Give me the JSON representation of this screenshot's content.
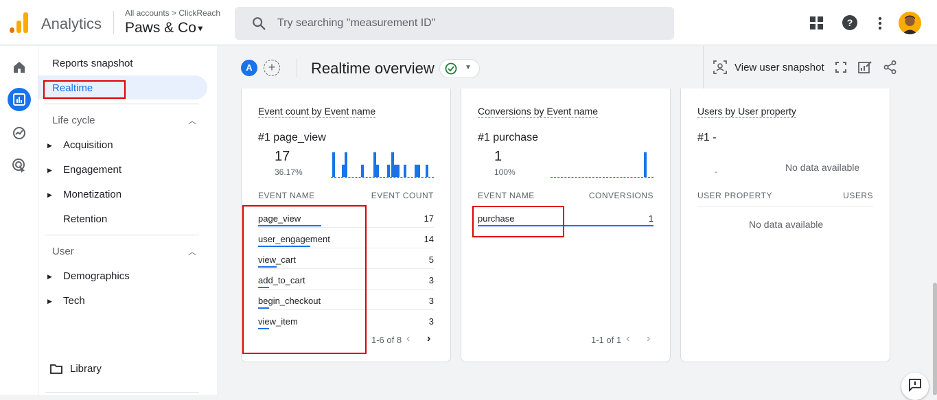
{
  "header": {
    "app_name": "Analytics",
    "breadcrumb": "All accounts > ClickReach",
    "property": "Paws & Co",
    "search_placeholder": "Try searching \"measurement ID\"",
    "icons": [
      "apps-grid-icon",
      "help-icon",
      "more-vert-icon",
      "avatar"
    ]
  },
  "rail": {
    "items": [
      "home-icon",
      "reports-icon",
      "explore-icon",
      "advertising-icon"
    ],
    "active": "reports-icon"
  },
  "nav": {
    "reports_snapshot": "Reports snapshot",
    "realtime": "Realtime",
    "lifecycle": "Life cycle",
    "lifecycle_items": [
      "Acquisition",
      "Engagement",
      "Monetization",
      "Retention"
    ],
    "user": "User",
    "user_items": [
      "Demographics",
      "Tech"
    ],
    "library": "Library"
  },
  "subheader": {
    "comparison_badge": "A",
    "add_comparison": "+",
    "title": "Realtime overview",
    "view_user_snapshot": "View user snapshot"
  },
  "cards": {
    "events": {
      "title": "Event count by Event name",
      "rank_label": "#1",
      "rank_name": "page_view",
      "top_value": "17",
      "top_pct": "36.17%",
      "col_name": "EVENT NAME",
      "col_value": "EVENT COUNT",
      "rows": [
        {
          "name": "page_view",
          "value": "17"
        },
        {
          "name": "user_engagement",
          "value": "14"
        },
        {
          "name": "view_cart",
          "value": "5"
        },
        {
          "name": "add_to_cart",
          "value": "3"
        },
        {
          "name": "begin_checkout",
          "value": "3"
        },
        {
          "name": "view_item",
          "value": "3"
        }
      ],
      "pager": "1-6 of 8"
    },
    "conversions": {
      "title": "Conversions by Event name",
      "rank_label": "#1",
      "rank_name": "purchase",
      "top_value": "1",
      "top_pct": "100%",
      "col_name": "EVENT NAME",
      "col_value": "CONVERSIONS",
      "rows": [
        {
          "name": "purchase",
          "value": "1"
        }
      ],
      "pager": "1-1 of 1"
    },
    "user_property": {
      "title": "Users by User property",
      "rank_label": "#1",
      "rank_name": "-",
      "dash": "-",
      "no_data": "No data available",
      "col_name": "USER PROPERTY",
      "col_value": "USERS",
      "table_no_data": "No data available"
    }
  },
  "colors": {
    "accent": "#1a73e8",
    "highlight_box": "#e00000",
    "success": "#188038"
  }
}
